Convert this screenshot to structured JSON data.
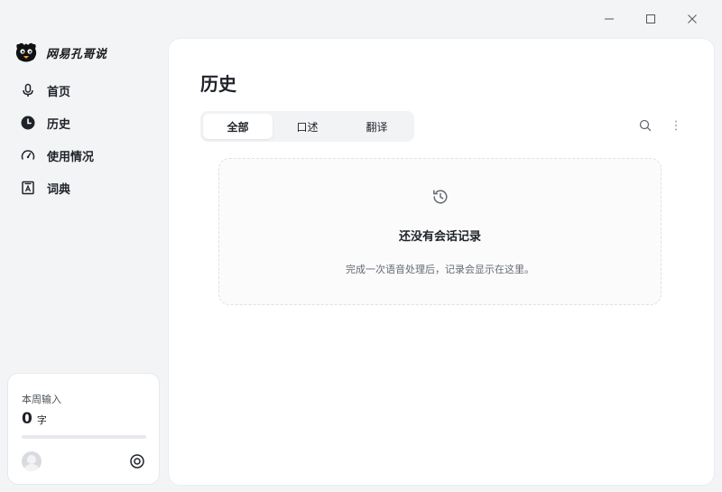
{
  "app": {
    "name": "网易孔哥说"
  },
  "window_controls": {
    "minimize": "minimize-icon",
    "maximize": "maximize-icon",
    "close": "close-icon"
  },
  "sidebar": {
    "items": [
      {
        "label": "首页",
        "icon": "microphone-icon"
      },
      {
        "label": "历史",
        "icon": "clock-icon",
        "active": true
      },
      {
        "label": "使用情况",
        "icon": "gauge-icon"
      },
      {
        "label": "词典",
        "icon": "dictionary-icon"
      }
    ],
    "usage": {
      "title": "本周输入",
      "count": "0",
      "unit": "字",
      "progress": 0
    }
  },
  "main": {
    "title": "历史",
    "tabs": [
      {
        "label": "全部",
        "active": true
      },
      {
        "label": "口述",
        "active": false
      },
      {
        "label": "翻译",
        "active": false
      }
    ],
    "empty": {
      "title": "还没有会话记录",
      "description": "完成一次语音处理后，记录会显示在这里。"
    }
  },
  "colors": {
    "accent": "#5b6cff",
    "background": "#f3f4f6",
    "panel": "#ffffff"
  }
}
